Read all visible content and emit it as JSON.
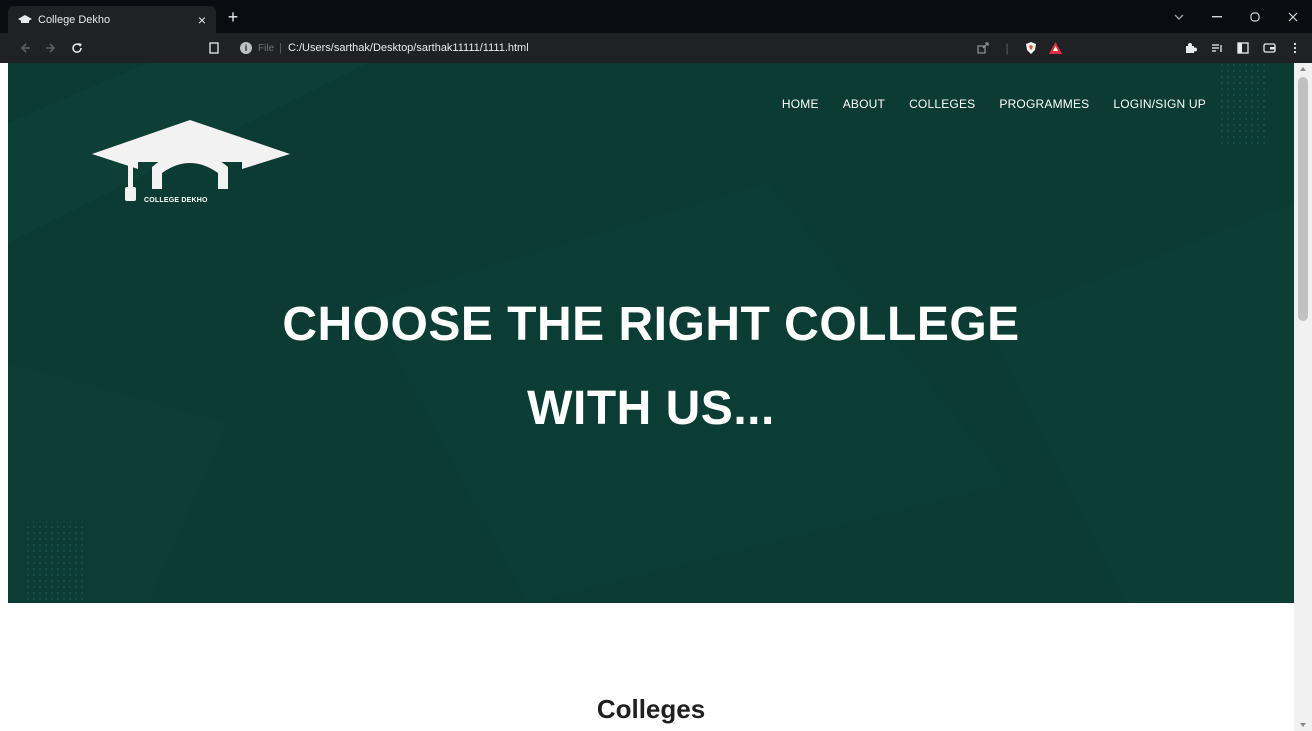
{
  "browser": {
    "tab_title": "College Dekho",
    "url_scheme": "File",
    "url": "C:/Users/sarthak/Desktop/sarthak11111/1111.html"
  },
  "page": {
    "nav": [
      "HOME",
      "ABOUT",
      "COLLEGES",
      "PROGRAMMES",
      "LOGIN/SIGN UP"
    ],
    "logo_text": "COLLEGE DEKHO",
    "hero_line1": "CHOOSE THE RIGHT COLLEGE",
    "hero_line2": "WITH US...",
    "section_title": "Colleges"
  },
  "colors": {
    "hero_bg": "#0b3b32",
    "chrome_dark": "#0b0b12",
    "toolbar": "#202124"
  }
}
